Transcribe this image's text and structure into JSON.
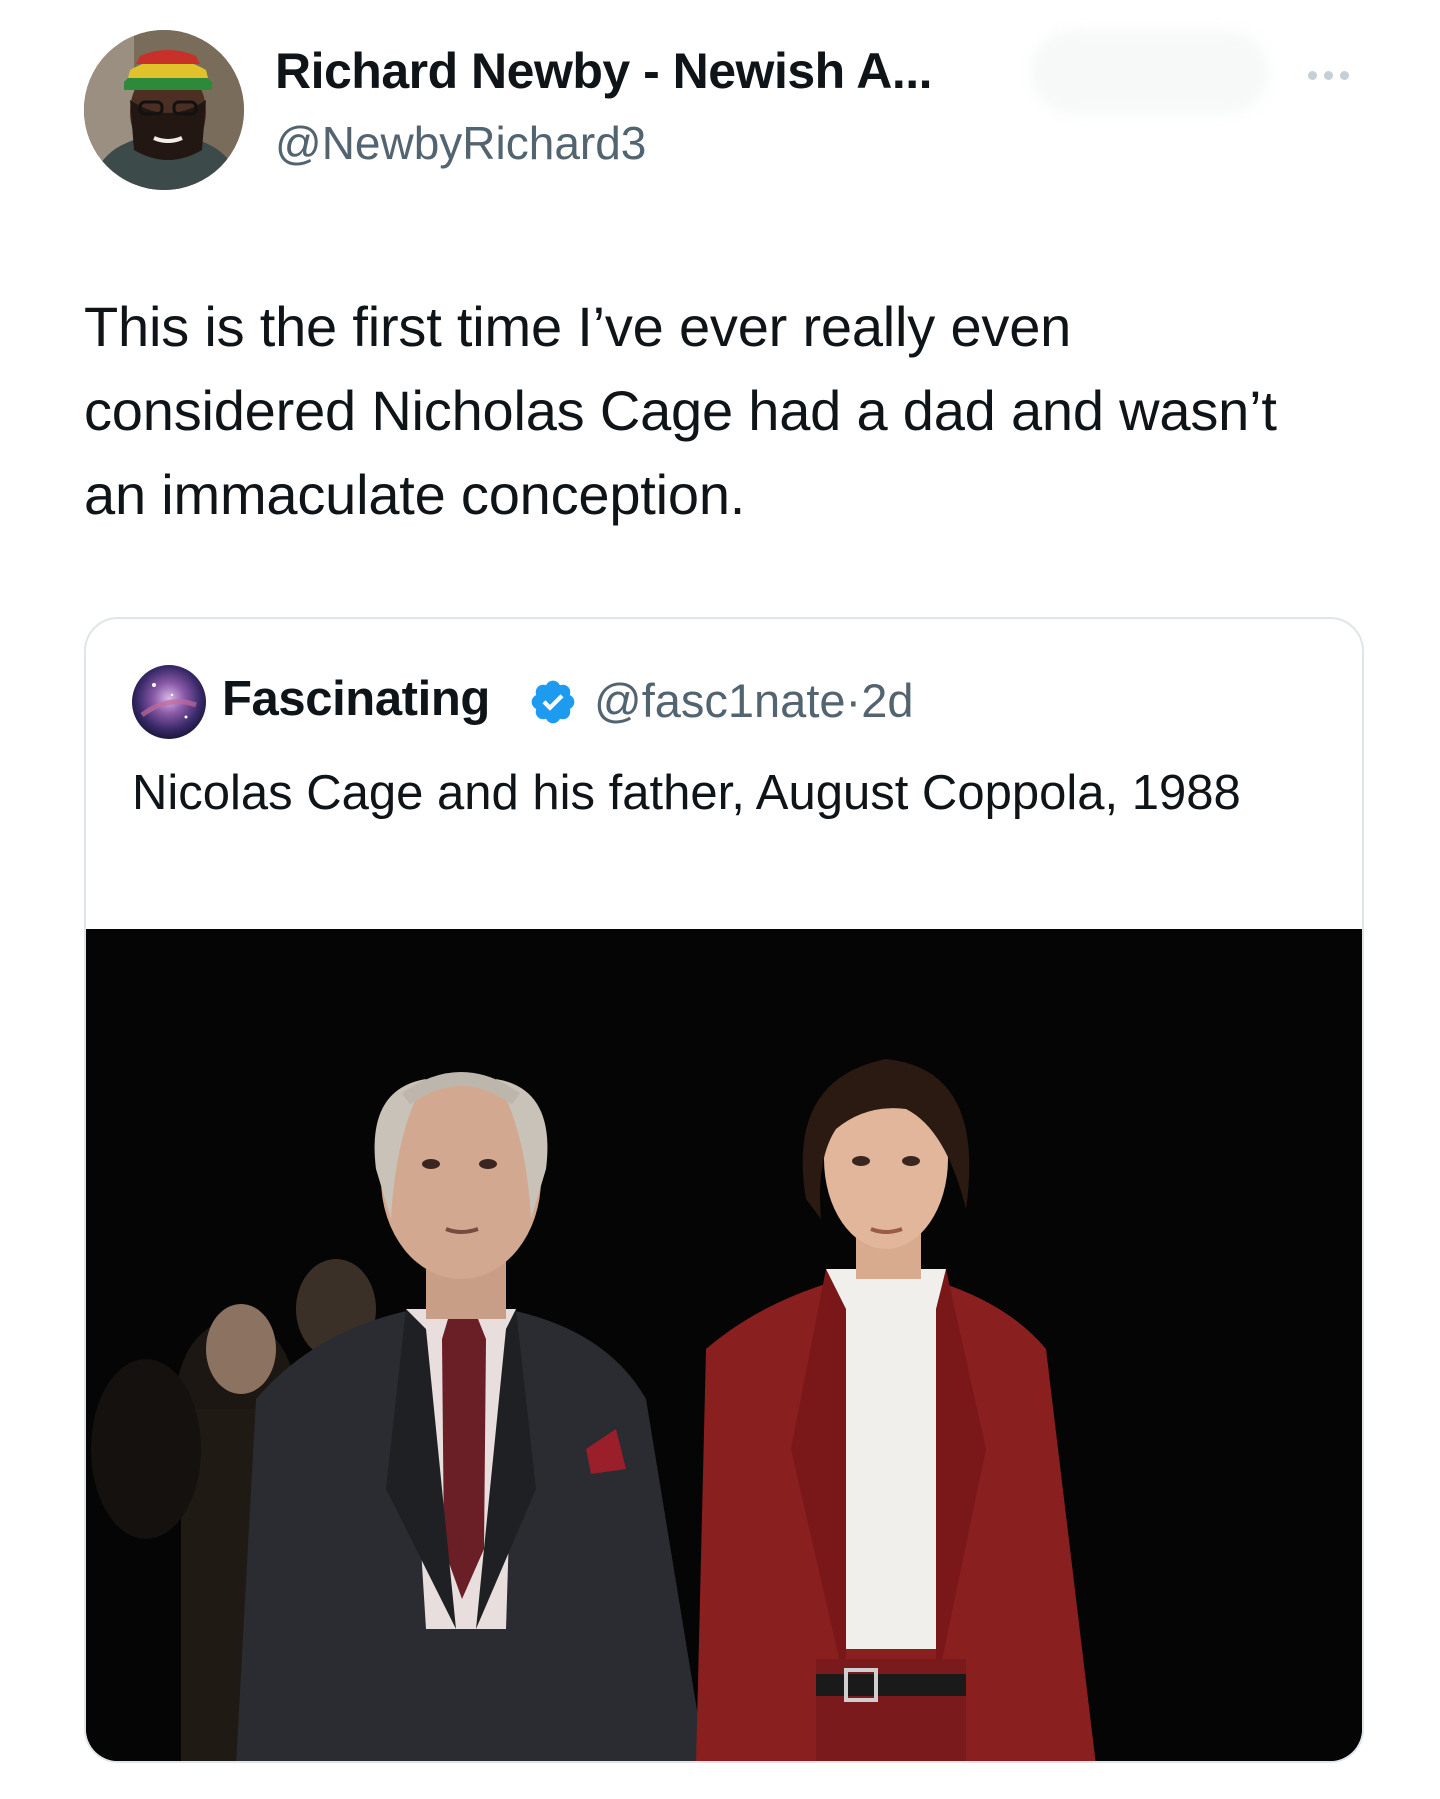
{
  "tweet": {
    "author": {
      "name": "Richard Newby - Newish A...",
      "handle": "@NewbyRichard3"
    },
    "text": "This is the first time I’ve ever really even considered Nicholas Cage had a dad and wasn’t an immaculate conception."
  },
  "quoted_tweet": {
    "author": {
      "name": "Fascinating",
      "handle": "@fasc1nate",
      "separator": "·",
      "time": "2d",
      "verified": true
    },
    "text": "Nicolas Cage and his father, August Coppola, 1988"
  },
  "icons": {
    "more": "more-options-icon",
    "verified": "verified-badge-icon"
  },
  "colors": {
    "text": "#0f1419",
    "secondary": "#536471",
    "verified": "#1d9bf0",
    "border": "#dfe5ea"
  }
}
